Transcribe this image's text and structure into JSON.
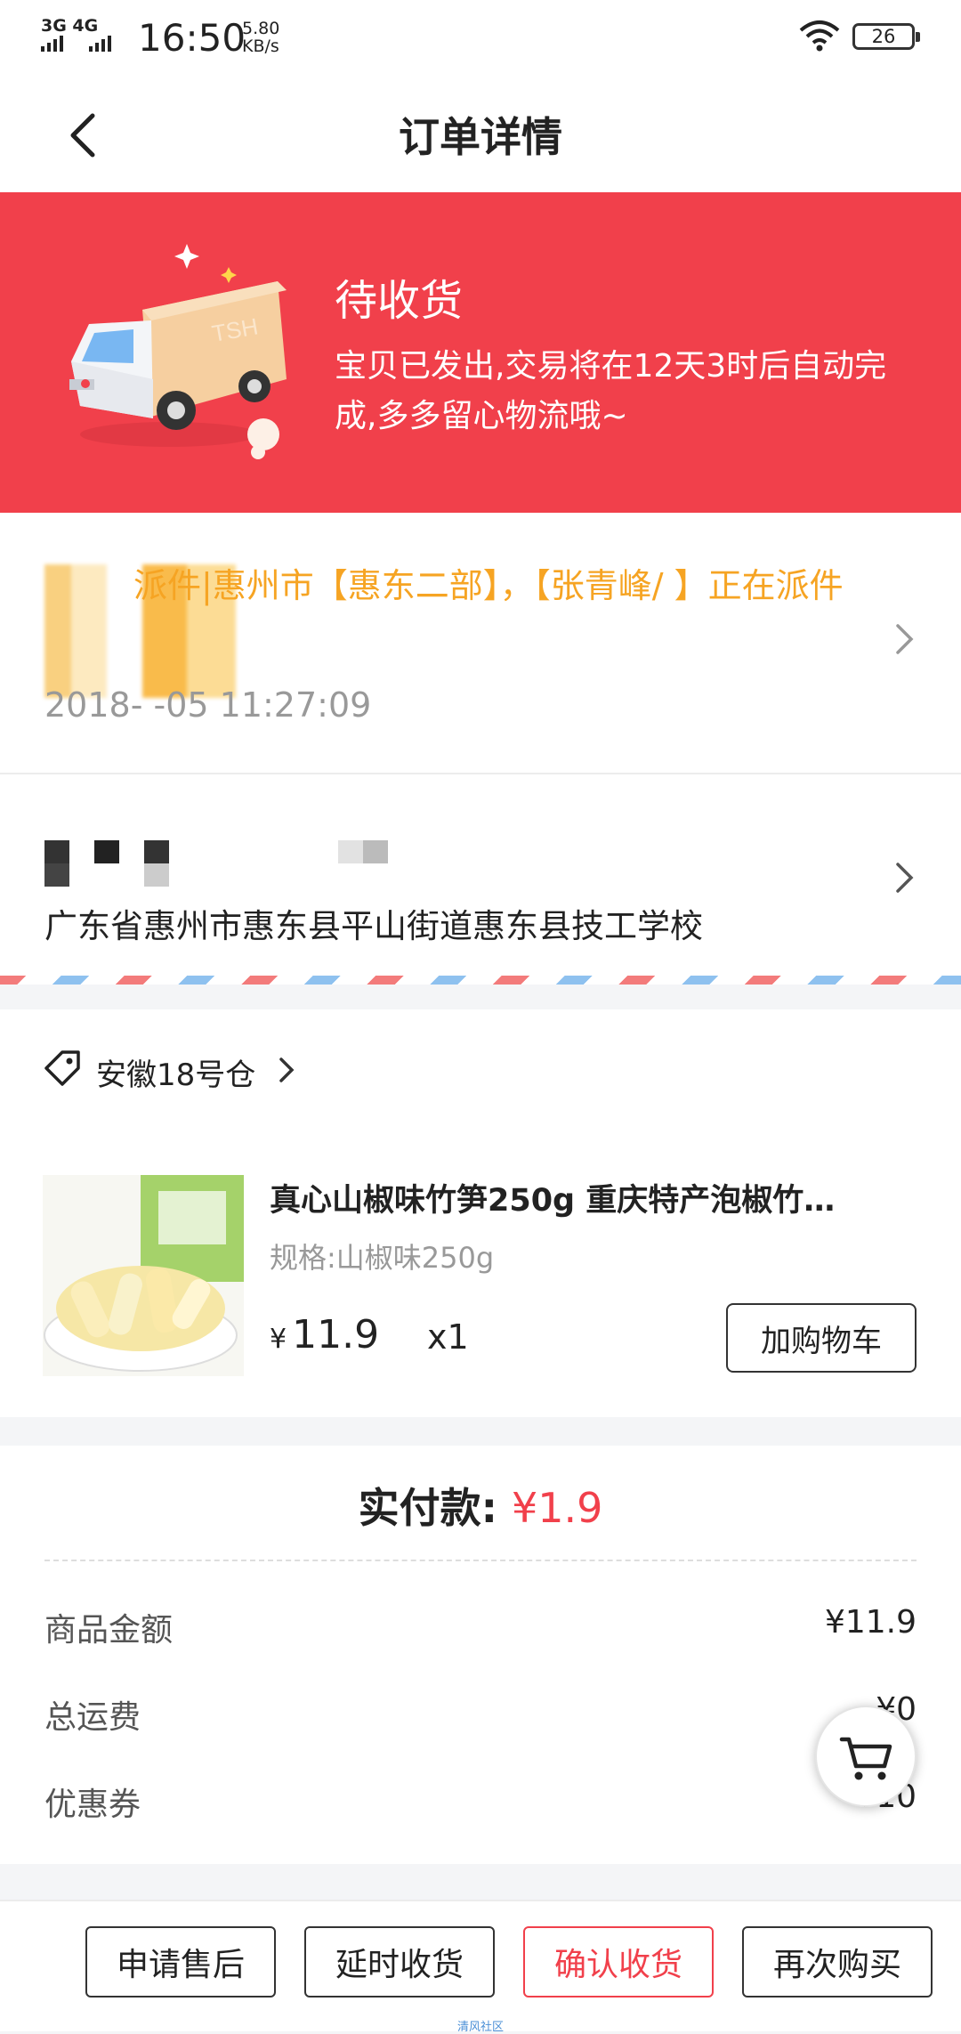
{
  "status_bar": {
    "network": "3G 4G",
    "time": "16:50",
    "speed_value": "5.80",
    "speed_unit": "KB/s",
    "battery": "26"
  },
  "nav": {
    "title": "订单详情"
  },
  "banner": {
    "title": "待收货",
    "desc": "宝贝已发出,交易将在12天3时后自动完成,多多留心物流哦~",
    "truck_text": "TSH",
    "color": "#f1404b"
  },
  "logistics": {
    "text": "派件|惠州市【惠东二部】，【张青峰/ 】正在派件",
    "time": "2018- -05 11:27:09",
    "color": "#f6a423"
  },
  "address": {
    "detail": "广东省惠州市惠东县平山街道惠东县技工学校"
  },
  "shop": {
    "name": "安徽18号仓"
  },
  "product": {
    "title": "真心山椒味竹笋250g 重庆特产泡椒竹…",
    "spec": "规格:山椒味250g",
    "currency": "¥",
    "price": "11.9",
    "qty": "x1",
    "add_cart_label": "加购物车"
  },
  "payment": {
    "total_label": "实付款:",
    "total_value": "¥1.9",
    "rows": [
      {
        "label": "商品金额",
        "value": "¥11.9"
      },
      {
        "label": "总运费",
        "value": "¥0"
      },
      {
        "label": "优惠券",
        "value": "-¥10"
      }
    ]
  },
  "actions": {
    "after_sale": "申请售后",
    "extend": "延时收货",
    "confirm": "确认收货",
    "rebuy": "再次购买"
  },
  "watermark": "清风社区",
  "icons": [
    "back-chevron-icon",
    "truck-illustration",
    "chevron-right-icon",
    "tag-icon",
    "shopping-cart-icon",
    "wifi-icon"
  ]
}
